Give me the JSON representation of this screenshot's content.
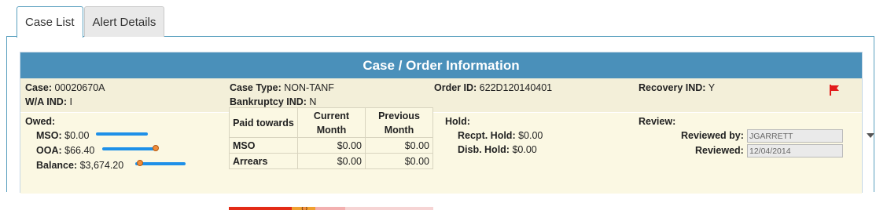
{
  "tabs": [
    {
      "label": "Case List",
      "active": true
    },
    {
      "label": "Alert Details",
      "active": false
    }
  ],
  "card": {
    "title": "Case / Order Information"
  },
  "case_info": {
    "case_label": "Case:",
    "case_value": "00020670A",
    "wa_ind_label": "W/A IND:",
    "wa_ind_value": "I",
    "case_type_label": "Case Type:",
    "case_type_value": "NON-TANF",
    "bankruptcy_label": "Bankruptcy IND:",
    "bankruptcy_value": "N",
    "order_id_label": "Order ID:",
    "order_id_value": "622D120140401",
    "recovery_label": "Recovery IND:",
    "recovery_value": "Y",
    "flag_color": "#e21b1b"
  },
  "owed": {
    "title": "Owed:",
    "items": [
      {
        "label": "MSO:",
        "value": "$0.00"
      },
      {
        "label": "OOA:",
        "value": "$66.40",
        "level": 0.95
      },
      {
        "label": "Balance:",
        "value": "$3,674.20",
        "level": 0.1
      }
    ]
  },
  "paid_table": {
    "headers": [
      "Paid towards",
      "Current Month",
      "Previous Month"
    ],
    "rows": [
      {
        "name": "MSO",
        "current": "$0.00",
        "previous": "$0.00"
      },
      {
        "name": "Arrears",
        "current": "$0.00",
        "previous": "$0.00"
      }
    ],
    "progress": 0.37
  },
  "hold": {
    "title": "Hold:",
    "recpt_label": "Recpt. Hold:",
    "recpt_value": "$0.00",
    "disb_label": "Disb. Hold:",
    "disb_value": "$0.00"
  },
  "review": {
    "title": "Review:",
    "reviewed_by_label": "Reviewed by:",
    "reviewed_by_value": "JGARRETT",
    "reviewed_label": "Reviewed:",
    "reviewed_value": "12/04/2014"
  },
  "colors": {
    "header_blue": "#4a90ba",
    "slider_blue": "#1e90e8",
    "slider_thumb": "#f08c3a"
  }
}
